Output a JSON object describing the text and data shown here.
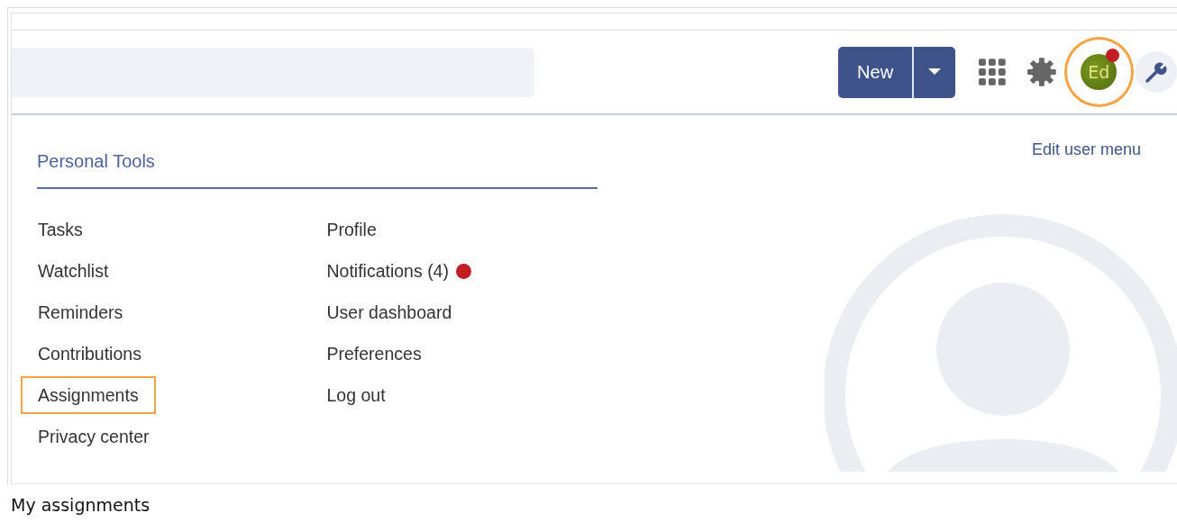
{
  "header": {
    "new_button": {
      "label": "New"
    },
    "avatar": {
      "initials": "Ed",
      "highlighted": true,
      "notification_dot": true
    }
  },
  "menu": {
    "title": "Personal Tools",
    "edit_link": "Edit user menu",
    "columns": [
      [
        {
          "label": "Tasks",
          "highlighted": false,
          "notification_dot": false
        },
        {
          "label": "Watchlist",
          "highlighted": false,
          "notification_dot": false
        },
        {
          "label": "Reminders",
          "highlighted": false,
          "notification_dot": false
        },
        {
          "label": "Contributions",
          "highlighted": false,
          "notification_dot": false
        },
        {
          "label": "Assignments",
          "highlighted": true,
          "notification_dot": false
        },
        {
          "label": "Privacy center",
          "highlighted": false,
          "notification_dot": false
        }
      ],
      [
        {
          "label": "Profile",
          "highlighted": false,
          "notification_dot": false
        },
        {
          "label": "Notifications (4)",
          "highlighted": false,
          "notification_dot": true
        },
        {
          "label": "User dashboard",
          "highlighted": false,
          "notification_dot": false
        },
        {
          "label": "Preferences",
          "highlighted": false,
          "notification_dot": false
        },
        {
          "label": "Log out",
          "highlighted": false,
          "notification_dot": false
        }
      ]
    ]
  },
  "caption": "My assignments"
}
